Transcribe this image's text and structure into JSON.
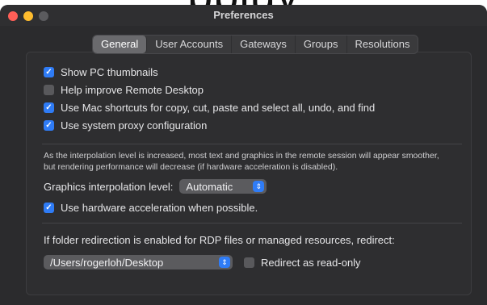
{
  "cropped_heading": "ppiuy",
  "window": {
    "title": "Preferences"
  },
  "tabs": [
    {
      "label": "General",
      "active": true
    },
    {
      "label": "User Accounts",
      "active": false
    },
    {
      "label": "Gateways",
      "active": false
    },
    {
      "label": "Groups",
      "active": false
    },
    {
      "label": "Resolutions",
      "active": false
    }
  ],
  "general": {
    "options": [
      {
        "label": "Show PC thumbnails",
        "checked": true
      },
      {
        "label": "Help improve Remote Desktop",
        "checked": false
      },
      {
        "label": "Use Mac shortcuts for copy, cut, paste and select all, undo, and find",
        "checked": true
      },
      {
        "label": "Use system proxy configuration",
        "checked": true
      }
    ],
    "interpolation_note_line1": "As the interpolation level is increased, most text and graphics in the remote session will appear smoother,",
    "interpolation_note_line2": "but rendering performance will decrease (if hardware acceleration is disabled).",
    "interpolation_label": "Graphics interpolation level:",
    "interpolation_value": "Automatic",
    "hardware_accel_label": "Use hardware acceleration when possible.",
    "hardware_accel_checked": true,
    "redirect_label": "If folder redirection is enabled for RDP files or managed resources, redirect:",
    "redirect_path": "/Users/rogerloh/Desktop",
    "readonly_label": "Redirect as read-only",
    "readonly_checked": false
  },
  "colors": {
    "accent": "#2f7cf6",
    "window_bg": "#2b2b2d",
    "close": "#ff5f57",
    "minimize": "#febc2e"
  }
}
